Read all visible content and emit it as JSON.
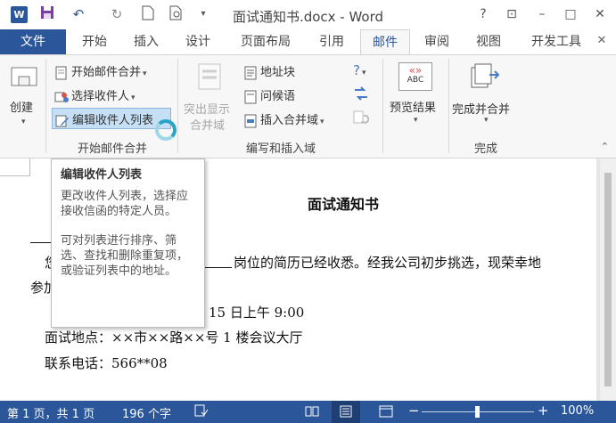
{
  "window": {
    "title": "面试通知书.docx - Word",
    "logo_letter": "W",
    "help": "?",
    "restore_ribbon": "⊡",
    "minimize": "–",
    "maximize": "□",
    "close": "✕"
  },
  "quick_access": {
    "save": "💾",
    "undo": "↶",
    "redo": "↻",
    "new_doc": "▯",
    "print_preview": "🔍",
    "more": "▾"
  },
  "tabs": [
    "文件",
    "开始",
    "插入",
    "设计",
    "页面布局",
    "引用",
    "邮件",
    "审阅",
    "视图",
    "开发工具"
  ],
  "active_tab": "邮件",
  "ribbon": {
    "create": "创建",
    "start_merge": "开始邮件合并",
    "select_recipients": "选择收件人",
    "edit_recipient_list": "编辑收件人列表",
    "highlight_fields_line1": "突出显示",
    "highlight_fields_line2": "合并域",
    "address_block": "地址块",
    "greeting_line": "问候语",
    "insert_merge_field": "插入合并域",
    "preview_results": "预览结果",
    "finish_merge": "完成并合并",
    "group_start": "开始邮件合并",
    "group_write": "编写和插入域",
    "group_finish": "完成",
    "abc_icon": "ABC"
  },
  "tooltip": {
    "title": "编辑收件人列表",
    "p1": "更改收件人列表，选择应接收信函的特定人员。",
    "p2": "可对列表进行排序、筛选、查找和删除重复项，或验证列表中的地址。"
  },
  "document": {
    "heading": "面试通知书",
    "line1": "岗位的简历已经收悉。经我公司初步挑选，现荣幸地",
    "line1_prefix": "您",
    "line2_prefix": "参加",
    "line3": "15 日上午 9:00",
    "line4": "面试地点：××市××路××号 1 楼会议大厅",
    "line5": "联系电话：566**08"
  },
  "status": {
    "page": "第 1 页，共 1 页",
    "words": "196 个字",
    "zoom": "100%",
    "zoom_minus": "−",
    "zoom_plus": "+"
  },
  "colors": {
    "accent": "#2b579a",
    "ribbon_bg": "#f7f7f7",
    "tooltip_border": "#bdbdbd"
  }
}
